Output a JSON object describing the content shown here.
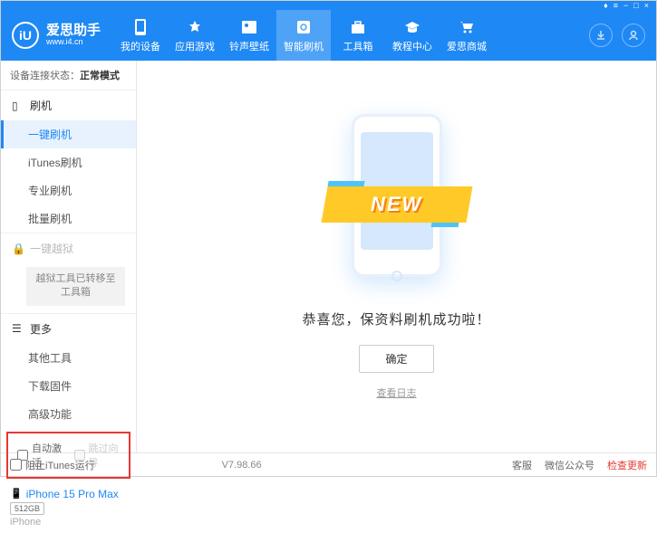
{
  "titlebar": {
    "gift": "♦",
    "menu": "≡",
    "min": "−",
    "max": "□",
    "close": "×"
  },
  "logo": {
    "monogram": "iU",
    "title": "爱思助手",
    "url": "www.i4.cn"
  },
  "nav": [
    {
      "label": "我的设备"
    },
    {
      "label": "应用游戏"
    },
    {
      "label": "铃声壁纸"
    },
    {
      "label": "智能刷机"
    },
    {
      "label": "工具箱"
    },
    {
      "label": "教程中心"
    },
    {
      "label": "爱思商城"
    }
  ],
  "status": {
    "prefix": "设备连接状态：",
    "value": "正常模式"
  },
  "sidebar": {
    "group1": {
      "title": "刷机",
      "items": [
        "一键刷机",
        "iTunes刷机",
        "专业刷机",
        "批量刷机"
      ]
    },
    "group2": {
      "title": "一键越狱",
      "banner": "越狱工具已转移至\n工具箱"
    },
    "group3": {
      "title": "更多",
      "items": [
        "其他工具",
        "下载固件",
        "高级功能"
      ]
    }
  },
  "checks": {
    "auto_activate": "自动激活",
    "skip_guide": "跳过向导"
  },
  "device": {
    "name": "iPhone 15 Pro Max",
    "capacity": "512GB",
    "type": "iPhone"
  },
  "content": {
    "new_badge": "NEW",
    "success": "恭喜您，保资料刷机成功啦！",
    "ok": "确定",
    "view_log": "查看日志"
  },
  "footer": {
    "block_itunes": "阻止iTunes运行",
    "version": "V7.98.66",
    "links": [
      "客服",
      "微信公众号",
      "检查更新"
    ]
  }
}
